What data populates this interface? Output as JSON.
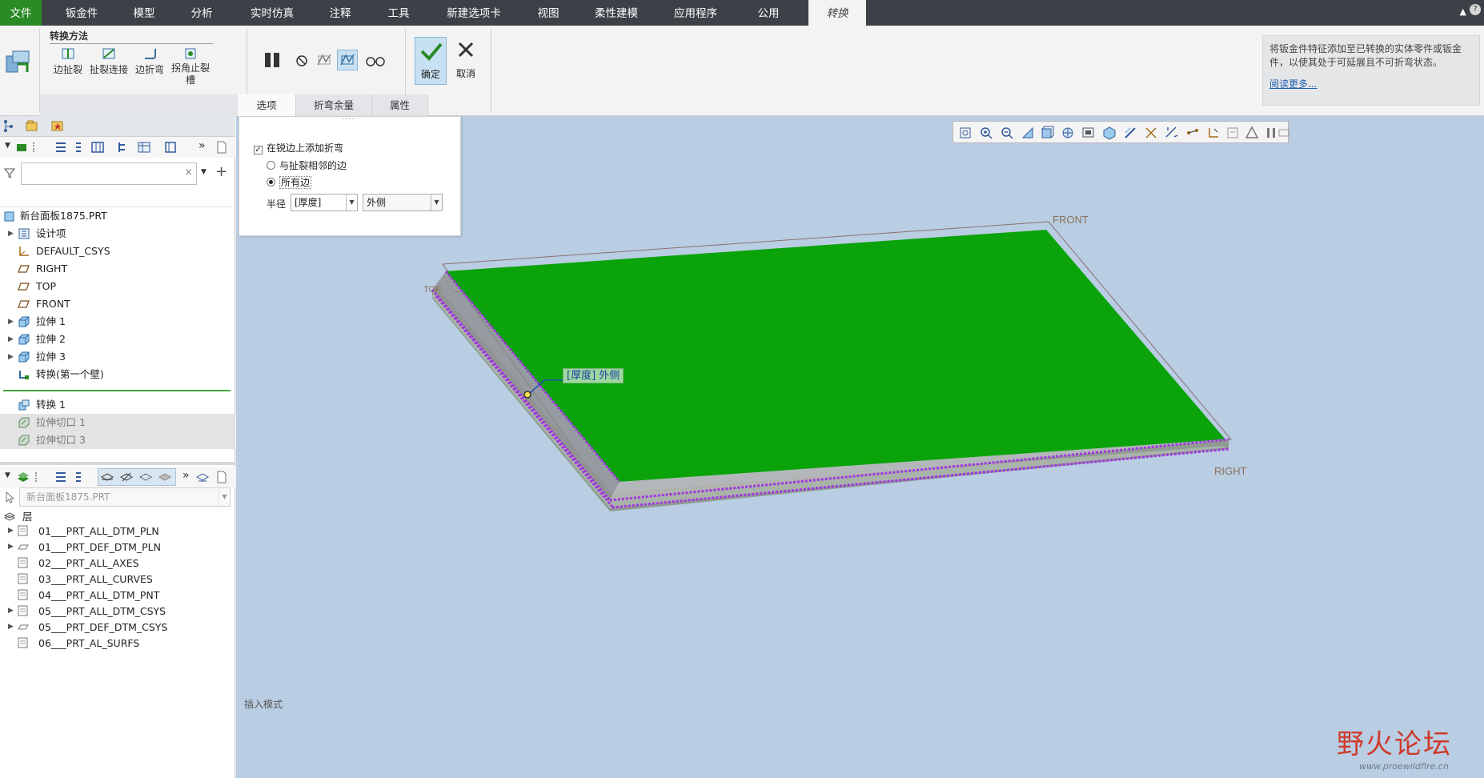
{
  "menu": {
    "tabs": [
      "文件",
      "钣金件",
      "模型",
      "分析",
      "实时仿真",
      "注释",
      "工具",
      "新建选项卡",
      "视图",
      "柔性建模",
      "应用程序",
      "公用",
      "转换"
    ],
    "active": "转换"
  },
  "ribbon": {
    "group_title": "转换方法",
    "methods": [
      "边扯裂",
      "扯裂连接",
      "边折弯",
      "拐角止裂槽"
    ],
    "confirm_label": "确定",
    "cancel_label": "取消",
    "tabs": [
      "选项",
      "折弯余量",
      "属性"
    ],
    "active_tab": "选项",
    "help_text": "将钣金件特征添加至已转换的实体零件或钣金件，以使其处于可延展且不可折弯状态。",
    "help_more": "阅读更多..."
  },
  "options": {
    "add_bends_label": "在锐边上添加折弯",
    "add_bends_checked": true,
    "radio_adjacent": "与扯裂相邻的边",
    "radio_all": "所有边",
    "radio_selected": "所有边",
    "radius_label": "半径",
    "radius_value": "[厚度]",
    "side_value": "外侧"
  },
  "model_tree": {
    "search_placeholder": "",
    "items": [
      {
        "label": "新台面板1875.PRT",
        "icon": "part-icon"
      },
      {
        "label": "设计项",
        "icon": "design-items-icon"
      },
      {
        "label": "DEFAULT_CSYS",
        "icon": "csys-icon"
      },
      {
        "label": "RIGHT",
        "icon": "datum-plane-icon"
      },
      {
        "label": "TOP",
        "icon": "datum-plane-icon"
      },
      {
        "label": "FRONT",
        "icon": "datum-plane-icon"
      },
      {
        "label": "拉伸 1",
        "icon": "extrude-icon"
      },
      {
        "label": "拉伸 2",
        "icon": "extrude-icon"
      },
      {
        "label": "拉伸 3",
        "icon": "extrude-icon"
      },
      {
        "label": "转换(第一个壁)",
        "icon": "convert-wall-icon"
      },
      {
        "label": "转换 1",
        "icon": "convert-icon"
      },
      {
        "label": "拉伸切口 1",
        "icon": "extrude-cut-icon"
      },
      {
        "label": "拉伸切口 3",
        "icon": "extrude-cut-icon"
      }
    ]
  },
  "layers": {
    "model_combo": "新台面板1875.PRT",
    "header": "层",
    "items": [
      "01___PRT_ALL_DTM_PLN",
      "01___PRT_DEF_DTM_PLN",
      "02___PRT_ALL_AXES",
      "03___PRT_ALL_CURVES",
      "04___PRT_ALL_DTM_PNT",
      "05___PRT_ALL_DTM_CSYS",
      "05___PRT_DEF_DTM_CSYS",
      "06___PRT_AL_SURFS"
    ]
  },
  "viewport": {
    "datum_front": "FRONT",
    "datum_right": "RIGHT",
    "datum_top": "TOP",
    "dim_label": "[厚度] 外侧",
    "status": "插入模式",
    "colors": {
      "face": "#0aa30a",
      "background": "#b9cde3",
      "highlight": "#a035e0",
      "edge": "#8a8a8a"
    }
  },
  "watermark": {
    "brand": "野火论坛",
    "url": "www.proewildfire.cn"
  }
}
